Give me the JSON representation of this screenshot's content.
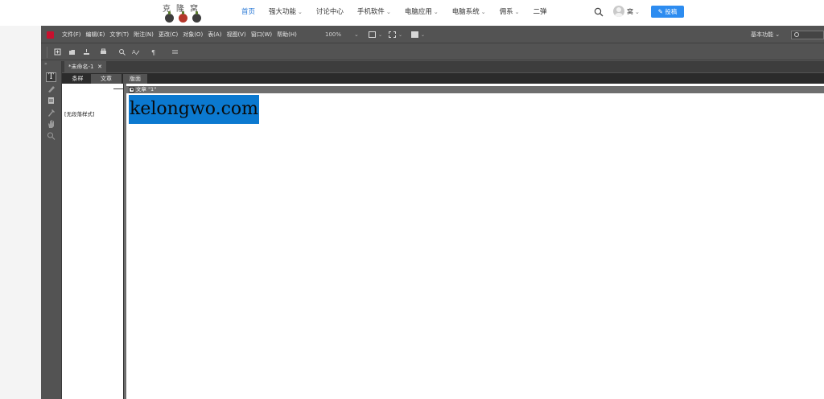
{
  "site": {
    "logo_text": "克隆窝",
    "nav": [
      {
        "label": "首页",
        "active": true,
        "has_dropdown": false
      },
      {
        "label": "强大功能",
        "active": false,
        "has_dropdown": true
      },
      {
        "label": "讨论中心",
        "active": false,
        "has_dropdown": false
      },
      {
        "label": "手机软件",
        "active": false,
        "has_dropdown": true
      },
      {
        "label": "电脑应用",
        "active": false,
        "has_dropdown": true
      },
      {
        "label": "电脑系统",
        "active": false,
        "has_dropdown": true
      },
      {
        "label": "佣系",
        "active": false,
        "has_dropdown": true
      },
      {
        "label": "二弹",
        "active": false,
        "has_dropdown": false
      }
    ],
    "user_label": "窝",
    "submit_label": "投稿",
    "accent_color": "#2d8cf0"
  },
  "app": {
    "menu": [
      "文件(F)",
      "编辑(E)",
      "文字(T)",
      "附注(N)",
      "更改(C)",
      "对象(O)",
      "表(A)",
      "视图(V)",
      "窗口(W)",
      "帮助(H)"
    ],
    "zoom": "100%",
    "workspace": "基本功能",
    "document_tab": "*未命名-1",
    "sub_tabs": [
      "条样",
      "文章",
      "版面"
    ],
    "style_label": "[无段落样式]",
    "story_label": "文章 \"1\"",
    "text_content": "kelongwo.com",
    "selection_color": "#0b79d0",
    "icons": {
      "toolbar": [
        "new-icon",
        "open-icon",
        "save-icon",
        "print-icon",
        "find-icon",
        "spell-icon",
        "pilcrow-icon",
        "align-icon"
      ],
      "tools": [
        "type-tool-icon",
        "note-tool-icon",
        "position-tool-icon",
        "eyedropper-icon",
        "hand-icon",
        "zoom-icon"
      ]
    }
  }
}
